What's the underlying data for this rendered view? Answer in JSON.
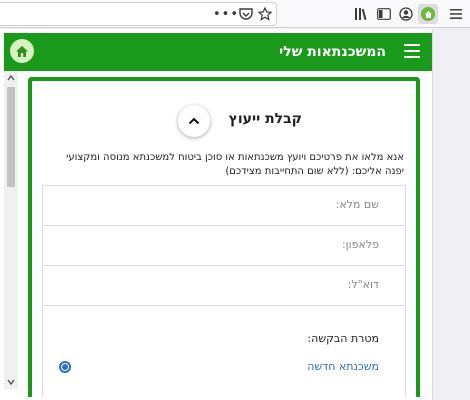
{
  "browser": {
    "overflow_label": "•••",
    "icons": [
      "more-icon",
      "pocket-icon",
      "bookmark-star-icon",
      "library-icon",
      "sidebar-toggle-icon",
      "account-icon",
      "extension-icon",
      "menu-icon"
    ]
  },
  "header": {
    "title": "המשכנתאות שלי",
    "accent_color": "#1a9a1a"
  },
  "card": {
    "title": "קבלת ייעוץ",
    "intro": "אנא מלאו את פרטיכם ויועץ משכנתאות או סוכן ביטוח למשכנתא מנוסה ומקצועי יפנה אליכם: (ללא שום התחייבות מצידכם)"
  },
  "form": {
    "fields": [
      {
        "label": "שם מלא:"
      },
      {
        "label": "פלאפון:"
      },
      {
        "label": "דוא\"ל:"
      }
    ],
    "request_purpose_label": "מטרת הבקשה:",
    "radio_option": "משכנתא חדשה"
  }
}
